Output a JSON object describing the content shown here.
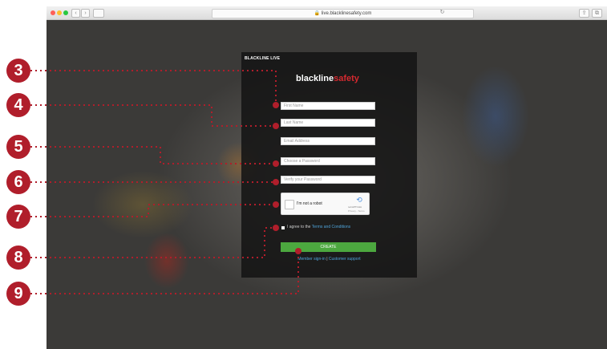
{
  "browser": {
    "url": "live.blacklinesafety.com",
    "nav_back": "‹",
    "nav_forward": "›"
  },
  "panel": {
    "tag": "BLACKLINE LIVE",
    "logo_main": "blackline",
    "logo_accent": "safety",
    "fields": {
      "first_name": "First Name",
      "last_name": "Last Name",
      "email": "Email Address",
      "password": "Choose a Password",
      "verify": "Verify your Password"
    },
    "captcha": {
      "label": "I'm not a robot",
      "brand": "reCAPTCHA",
      "sub": "Privacy - Terms"
    },
    "agree_prefix": "I agree to the ",
    "agree_link": "Terms and Conditions",
    "create_label": "CREATE",
    "member_signin": "Member sign-in",
    "separator": " | ",
    "customer_support": "Customer support"
  },
  "callouts": [
    "3",
    "4",
    "5",
    "6",
    "7",
    "8",
    "9"
  ],
  "colors": {
    "accent_red": "#b01e2b",
    "create_green": "#4ca83f",
    "link_blue": "#4fa3d9",
    "logo_red": "#d4292f"
  }
}
